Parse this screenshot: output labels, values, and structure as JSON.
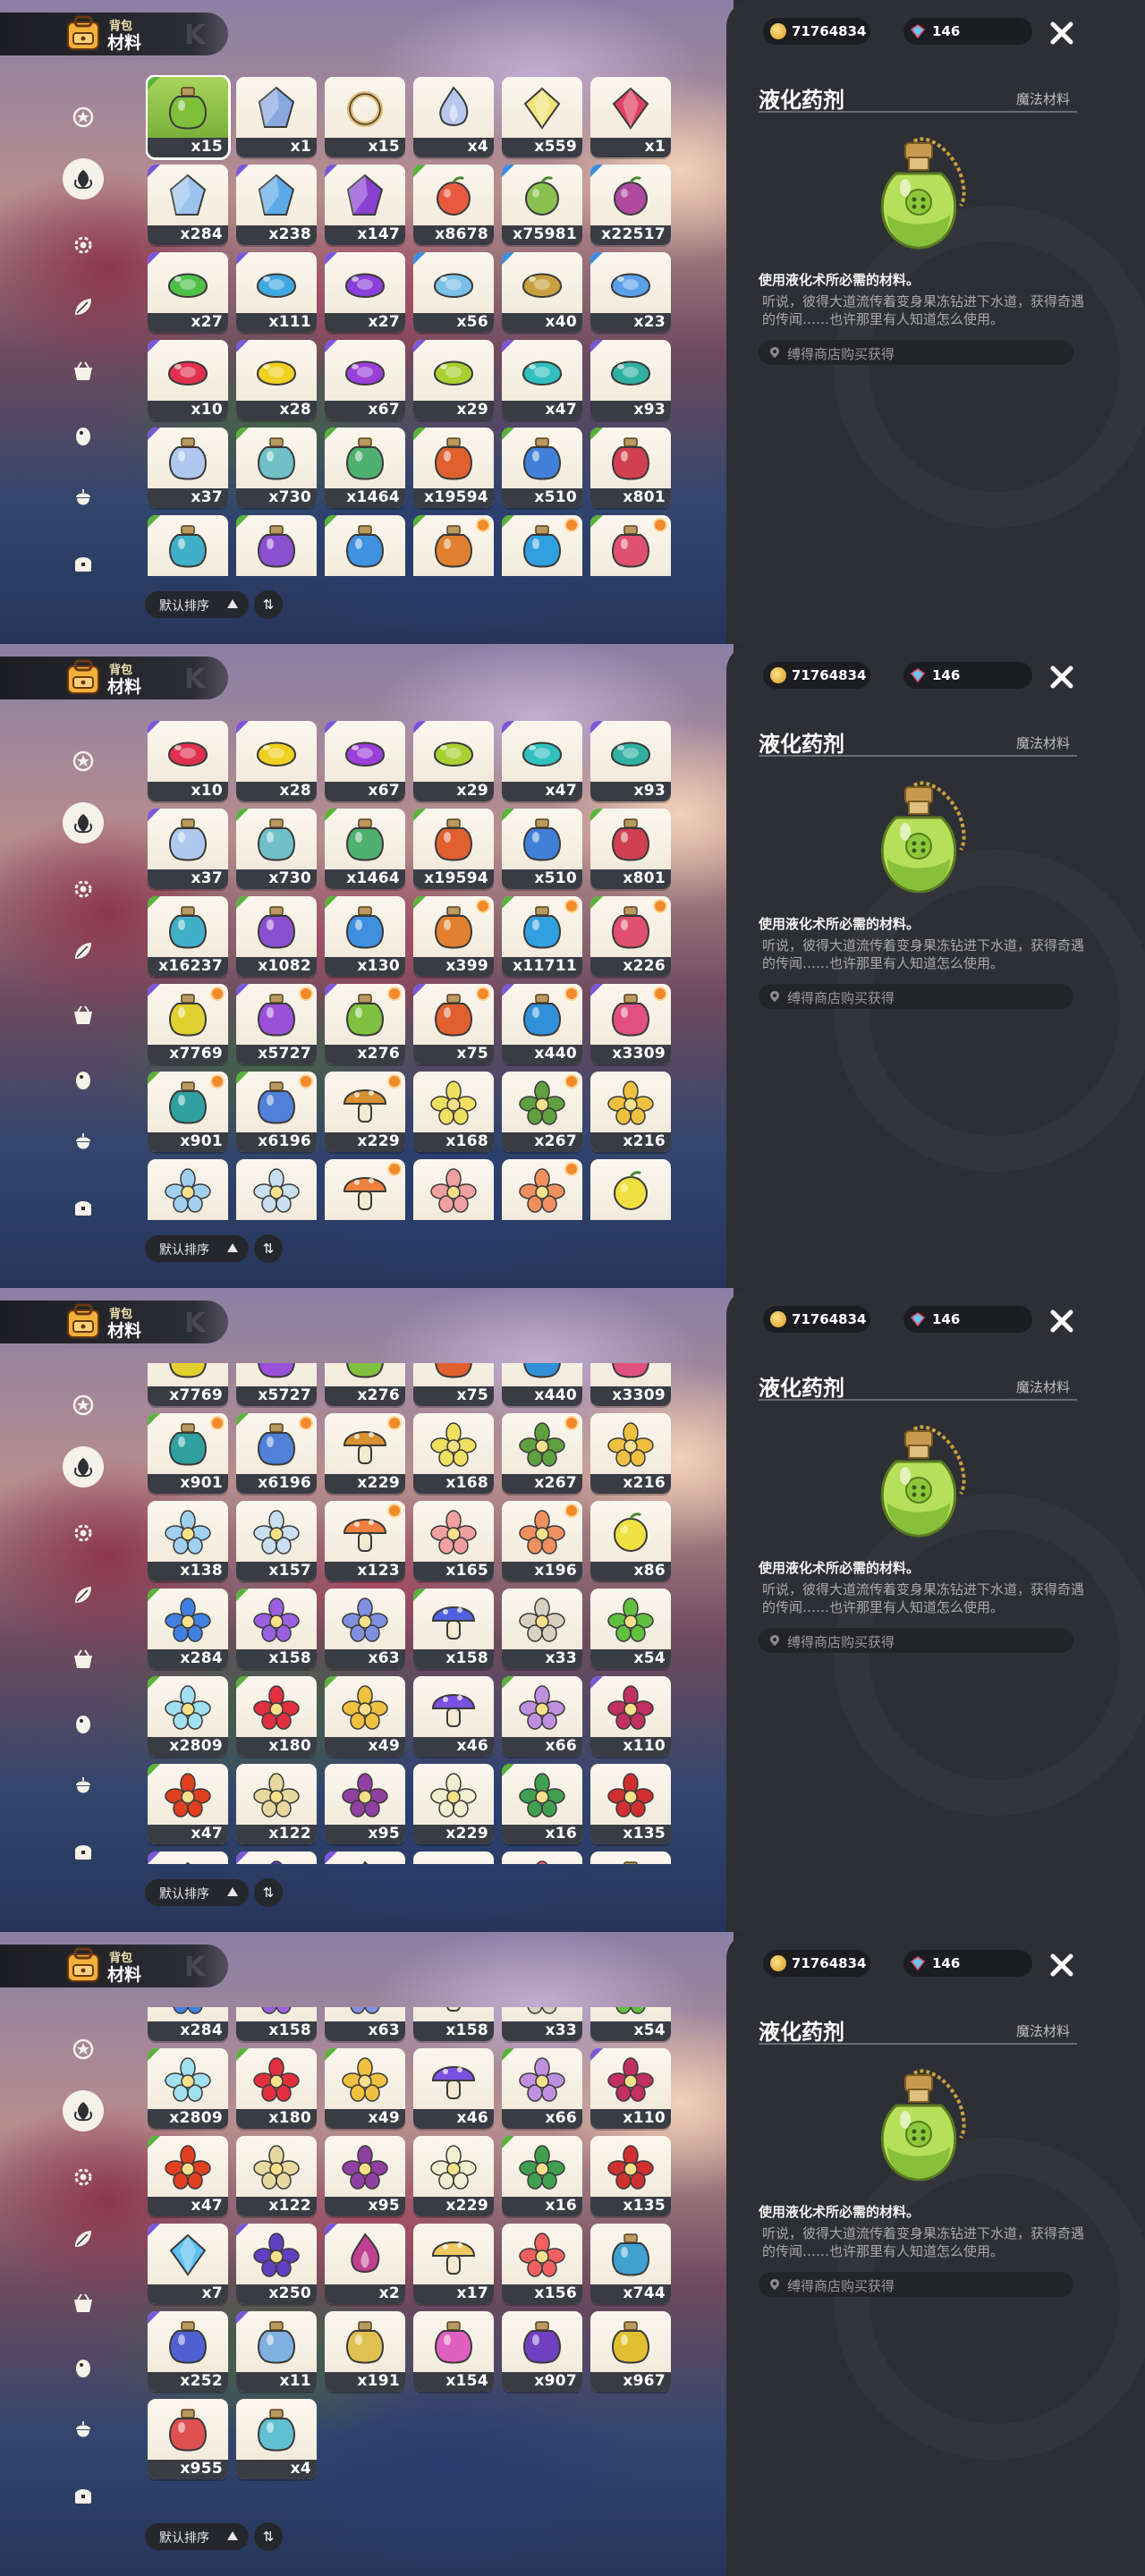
{
  "header": {
    "bag_small": "背包",
    "bag_big": "材料",
    "coins": "71764834",
    "gems": "146"
  },
  "sidebar": {
    "icons": [
      "badge-icon",
      "leaf-material-icon",
      "gear-icon",
      "leaf-icon",
      "basket-icon",
      "egg-icon",
      "acorn-icon",
      "chest-icon"
    ],
    "active_index": 1
  },
  "sort": {
    "label": "默认排序"
  },
  "detail": {
    "title": "液化药剂",
    "category": "魔法材料",
    "description": "使用液化术所必需的材料。",
    "lore": "听说，彼得大道流传着变身果冻钻进下水道，获得奇遇的传闻……也许那里有人知道怎么使用。",
    "source": "缚得商店购买获得"
  },
  "colors": {
    "accent_green": "#6aa52f",
    "rarity_purple": "#7b57d8",
    "panel_bg": "#2d2f34"
  },
  "items": [
    {
      "count": "x15",
      "color": "#7fbf3a",
      "shape": "potion",
      "corner": "green",
      "selected": true
    },
    {
      "count": "x1",
      "color": "#8aa8e0",
      "shape": "crystal",
      "corner": ""
    },
    {
      "count": "x15",
      "color": "#e0b870",
      "shape": "ring",
      "corner": ""
    },
    {
      "count": "x4",
      "color": "#b7c7ee",
      "shape": "flame",
      "corner": ""
    },
    {
      "count": "x559",
      "color": "#f2e27a",
      "shape": "gem",
      "corner": ""
    },
    {
      "count": "x1",
      "color": "#e04060",
      "shape": "gem",
      "corner": ""
    },
    {
      "count": "x284",
      "color": "#9bc3ee",
      "shape": "crystal",
      "corner": "purple"
    },
    {
      "count": "x238",
      "color": "#5ea9e8",
      "shape": "crystal",
      "corner": "purple"
    },
    {
      "count": "x147",
      "color": "#8a3fd0",
      "shape": "crystal",
      "corner": "purple"
    },
    {
      "count": "x8678",
      "color": "#e85a40",
      "shape": "fruit",
      "corner": "green"
    },
    {
      "count": "x75981",
      "color": "#8ac050",
      "shape": "fruit",
      "corner": "blue"
    },
    {
      "count": "x22517",
      "color": "#b04aa0",
      "shape": "fruit",
      "corner": "blue"
    },
    {
      "count": "x27",
      "color": "#4fbf4a",
      "shape": "jelly",
      "corner": "purple"
    },
    {
      "count": "x111",
      "color": "#3fa8e0",
      "shape": "jelly",
      "corner": "purple"
    },
    {
      "count": "x27",
      "color": "#8a3fd8",
      "shape": "jelly",
      "corner": "purple"
    },
    {
      "count": "x56",
      "color": "#7ac0e8",
      "shape": "jelly",
      "corner": "blue"
    },
    {
      "count": "x40",
      "color": "#c8a040",
      "shape": "jelly",
      "corner": "blue"
    },
    {
      "count": "x23",
      "color": "#5aa0e8",
      "shape": "jelly",
      "corner": "blue"
    },
    {
      "count": "x10",
      "color": "#e03050",
      "shape": "jelly",
      "corner": "purple"
    },
    {
      "count": "x28",
      "color": "#f0d020",
      "shape": "jelly",
      "corner": "purple"
    },
    {
      "count": "x67",
      "color": "#9a40d8",
      "shape": "jelly",
      "corner": "purple"
    },
    {
      "count": "x29",
      "color": "#a8d030",
      "shape": "jelly",
      "corner": "purple"
    },
    {
      "count": "x47",
      "color": "#30c0c0",
      "shape": "jelly",
      "corner": "purple"
    },
    {
      "count": "x93",
      "color": "#30b0a0",
      "shape": "jelly",
      "corner": "purple"
    },
    {
      "count": "x37",
      "color": "#b0c8ee",
      "shape": "potion",
      "corner": "purple"
    },
    {
      "count": "x730",
      "color": "#70c0c8",
      "shape": "potion",
      "corner": "green"
    },
    {
      "count": "x1464",
      "color": "#50b070",
      "shape": "potion",
      "corner": "green"
    },
    {
      "count": "x19594",
      "color": "#e06030",
      "shape": "potion",
      "corner": "green"
    },
    {
      "count": "x510",
      "color": "#4080d8",
      "shape": "potion",
      "corner": "green"
    },
    {
      "count": "x801",
      "color": "#d04050",
      "shape": "potion",
      "corner": "green"
    },
    {
      "count": "x16237",
      "color": "#40b0c8",
      "shape": "potion",
      "corner": "green"
    },
    {
      "count": "x1082",
      "color": "#8a50d0",
      "shape": "potion",
      "corner": "green"
    },
    {
      "count": "x130",
      "color": "#4090e0",
      "shape": "potion",
      "corner": "green"
    },
    {
      "count": "x399",
      "color": "#e08030",
      "shape": "potion",
      "corner": "green",
      "badge": true
    },
    {
      "count": "x11711",
      "color": "#30a0e0",
      "shape": "potion",
      "corner": "green",
      "badge": true
    },
    {
      "count": "x226",
      "color": "#e05070",
      "shape": "potion",
      "corner": "green",
      "badge": true
    },
    {
      "count": "x7769",
      "color": "#e0d030",
      "shape": "potion",
      "corner": "purple",
      "badge": true
    },
    {
      "count": "x5727",
      "color": "#9a50d8",
      "shape": "potion",
      "corner": "purple",
      "badge": true
    },
    {
      "count": "x276",
      "color": "#80c040",
      "shape": "potion",
      "corner": "purple",
      "badge": true
    },
    {
      "count": "x75",
      "color": "#e06030",
      "shape": "potion",
      "corner": "purple",
      "badge": true
    },
    {
      "count": "x440",
      "color": "#3090d8",
      "shape": "potion",
      "corner": "purple",
      "badge": true
    },
    {
      "count": "x3309",
      "color": "#e05080",
      "shape": "potion",
      "corner": "purple",
      "badge": true
    },
    {
      "count": "x901",
      "color": "#30a0a0",
      "shape": "potion",
      "corner": "green",
      "badge": true
    },
    {
      "count": "x6196",
      "color": "#5080d8",
      "shape": "potion",
      "corner": "green",
      "badge": true
    },
    {
      "count": "x229",
      "color": "#d89030",
      "shape": "mushroom",
      "corner": "",
      "badge": true
    },
    {
      "count": "x168",
      "color": "#f0e060",
      "shape": "flower",
      "corner": ""
    },
    {
      "count": "x267",
      "color": "#60a040",
      "shape": "flower",
      "corner": "",
      "badge": true
    },
    {
      "count": "x216",
      "color": "#f0c040",
      "shape": "flower",
      "corner": ""
    },
    {
      "count": "x138",
      "color": "#a0d0f0",
      "shape": "flower",
      "corner": ""
    },
    {
      "count": "x157",
      "color": "#c8e0f0",
      "shape": "flower",
      "corner": ""
    },
    {
      "count": "x123",
      "color": "#f08040",
      "shape": "mushroom",
      "corner": "",
      "badge": true
    },
    {
      "count": "x165",
      "color": "#f0a0a0",
      "shape": "flower",
      "corner": ""
    },
    {
      "count": "x196",
      "color": "#f09060",
      "shape": "flower",
      "corner": "",
      "badge": true
    },
    {
      "count": "x86",
      "color": "#f0e040",
      "shape": "fruit",
      "corner": ""
    },
    {
      "count": "x284",
      "color": "#4080e0",
      "shape": "flower",
      "corner": "green"
    },
    {
      "count": "x158",
      "color": "#9a60e0",
      "shape": "flower",
      "corner": "green"
    },
    {
      "count": "x63",
      "color": "#8090e0",
      "shape": "flower",
      "corner": ""
    },
    {
      "count": "x158",
      "color": "#5060e0",
      "shape": "mushroom",
      "corner": "green"
    },
    {
      "count": "x33",
      "color": "#d8d0c0",
      "shape": "flower",
      "corner": ""
    },
    {
      "count": "x54",
      "color": "#60c040",
      "shape": "flower",
      "corner": ""
    },
    {
      "count": "x2809",
      "color": "#a0e0f0",
      "shape": "flower",
      "corner": "green"
    },
    {
      "count": "x180",
      "color": "#e03040",
      "shape": "flower",
      "corner": "green"
    },
    {
      "count": "x49",
      "color": "#f0c040",
      "shape": "flower",
      "corner": "green"
    },
    {
      "count": "x46",
      "color": "#7a50e0",
      "shape": "mushroom",
      "corner": ""
    },
    {
      "count": "x66",
      "color": "#c090e0",
      "shape": "flower",
      "corner": "green"
    },
    {
      "count": "x110",
      "color": "#c03060",
      "shape": "flower",
      "corner": "purple"
    },
    {
      "count": "x47",
      "color": "#e04020",
      "shape": "flower",
      "corner": "green"
    },
    {
      "count": "x122",
      "color": "#e8d8a0",
      "shape": "flower",
      "corner": ""
    },
    {
      "count": "x95",
      "color": "#9040a0",
      "shape": "flower",
      "corner": ""
    },
    {
      "count": "x229",
      "color": "#f0f0d0",
      "shape": "flower",
      "corner": ""
    },
    {
      "count": "x16",
      "color": "#40a050",
      "shape": "flower",
      "corner": "green"
    },
    {
      "count": "x135",
      "color": "#d03030",
      "shape": "flower",
      "corner": ""
    },
    {
      "count": "x7",
      "color": "#60c0f0",
      "shape": "gem",
      "corner": "purple"
    },
    {
      "count": "x250",
      "color": "#6040c0",
      "shape": "flower",
      "corner": "purple"
    },
    {
      "count": "x2",
      "color": "#c04090",
      "shape": "flame",
      "corner": "purple"
    },
    {
      "count": "x17",
      "color": "#f0c860",
      "shape": "mushroom",
      "corner": ""
    },
    {
      "count": "x156",
      "color": "#f06060",
      "shape": "flower",
      "corner": ""
    },
    {
      "count": "x744",
      "color": "#40a0d0",
      "shape": "potion",
      "corner": ""
    },
    {
      "count": "x252",
      "color": "#5060d0",
      "shape": "potion",
      "corner": "purple"
    },
    {
      "count": "x11",
      "color": "#80b0e0",
      "shape": "potion",
      "corner": "purple"
    },
    {
      "count": "x191",
      "color": "#e0c050",
      "shape": "potion",
      "corner": ""
    },
    {
      "count": "x154",
      "color": "#e060c0",
      "shape": "potion",
      "corner": ""
    },
    {
      "count": "x907",
      "color": "#7040c0",
      "shape": "potion",
      "corner": ""
    },
    {
      "count": "x967",
      "color": "#e0c030",
      "shape": "potion",
      "corner": ""
    },
    {
      "count": "x955",
      "color": "#e05050",
      "shape": "potion",
      "corner": ""
    },
    {
      "count": "x4",
      "color": "#60c0d0",
      "shape": "potion",
      "corner": ""
    }
  ],
  "panels": [
    {
      "first_item_row": 0,
      "row_offset": 0
    },
    {
      "first_item_row": 3,
      "row_offset": 0
    },
    {
      "first_item_row": 6,
      "row_offset": 0.45
    },
    {
      "first_item_row": 9,
      "row_offset": 0.55
    }
  ]
}
